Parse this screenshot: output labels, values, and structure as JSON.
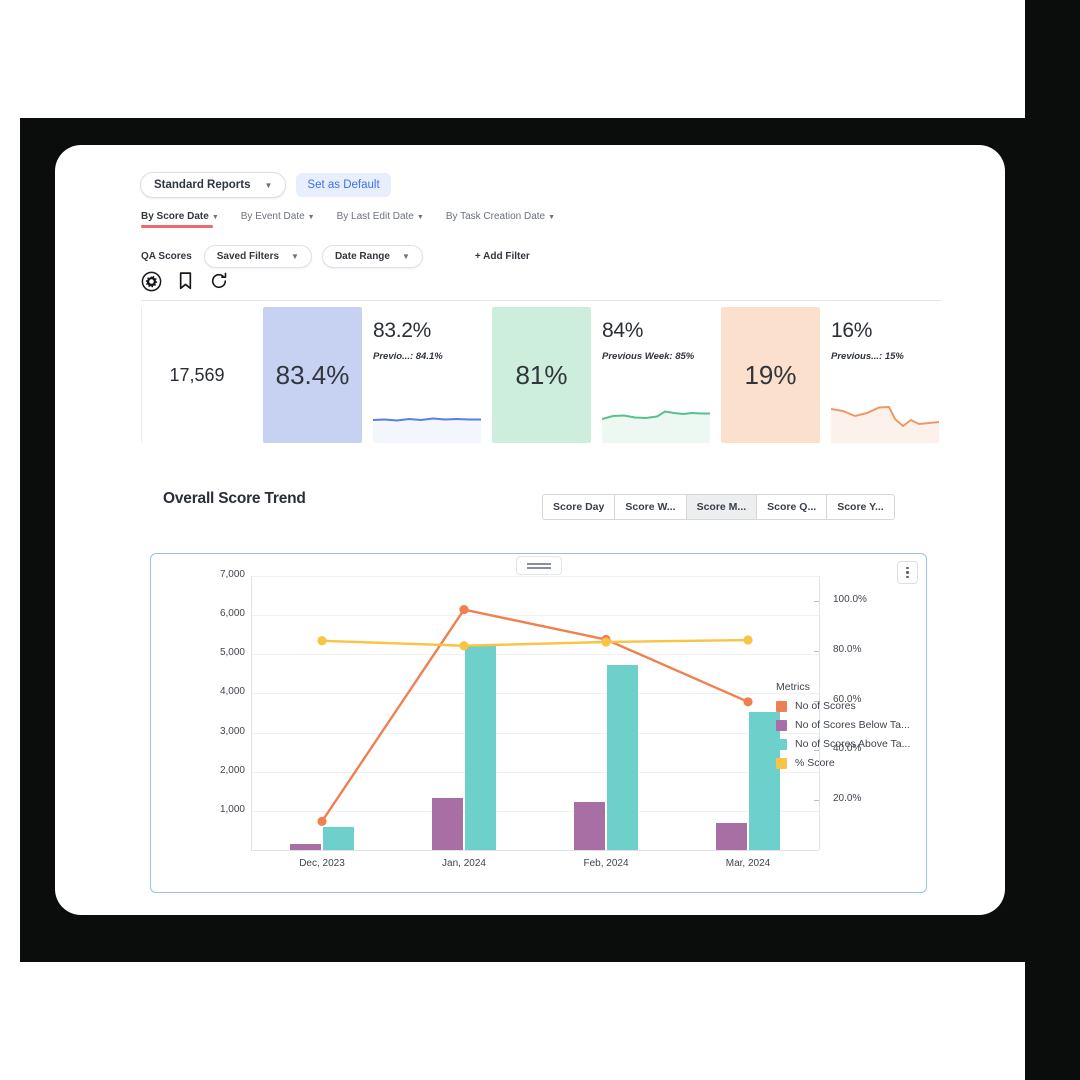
{
  "report": {
    "selector_label": "Standard Reports",
    "set_default_label": "Set as Default"
  },
  "date_tabs": [
    {
      "label": "By Score Date",
      "active": true
    },
    {
      "label": "By Event Date",
      "active": false
    },
    {
      "label": "By Last Edit Date",
      "active": false
    },
    {
      "label": "By Task Creation Date",
      "active": false
    }
  ],
  "filters": {
    "section_label": "QA Scores",
    "saved_filters_label": "Saved Filters",
    "date_range_label": "Date Range",
    "add_filter_label": "+ Add Filter"
  },
  "toolbar_icons": [
    {
      "name": "settings-gear-icon"
    },
    {
      "name": "bookmark-icon"
    },
    {
      "name": "refresh-history-icon"
    }
  ],
  "kpis": [
    {
      "kind": "plain",
      "value": "17,569",
      "bg": "#ffffff"
    },
    {
      "kind": "filled",
      "value": "83.4%",
      "bg": "#c7d2f3"
    },
    {
      "kind": "spark",
      "value": "83.2%",
      "previous": "Previo...: 84.1%",
      "line": "#5b7fe0",
      "fill": "#f4f6fd"
    },
    {
      "kind": "filled",
      "value": "81%",
      "bg": "#cdeedc"
    },
    {
      "kind": "spark",
      "value": "84%",
      "previous": "Previous Week: 85%",
      "line": "#58c08c",
      "fill": "#eef8f2"
    },
    {
      "kind": "filled",
      "value": "19%",
      "bg": "#fbe0cd"
    },
    {
      "kind": "spark",
      "value": "16%",
      "previous": "Previous...: 15%",
      "line": "#ee9866",
      "fill": "#fdf1eb"
    }
  ],
  "chart_section": {
    "title": "Overall Score Trend",
    "segments": [
      {
        "label": "Score Day",
        "active": false
      },
      {
        "label": "Score W...",
        "active": false
      },
      {
        "label": "Score M...",
        "active": true
      },
      {
        "label": "Score Q...",
        "active": false
      },
      {
        "label": "Score Y...",
        "active": false
      }
    ]
  },
  "chart_data": {
    "type": "bar",
    "title": "Overall Score Trend",
    "xlabel": "",
    "ylabel": "",
    "grid": true,
    "legend_position": "right",
    "legend_title": "Metrics",
    "categories": [
      "Dec, 2023",
      "Jan, 2024",
      "Feb, 2024",
      "Mar, 2024"
    ],
    "y_axis": {
      "side": "left",
      "ticks": [
        "1,000",
        "2,000",
        "3,000",
        "4,000",
        "5,000",
        "6,000",
        "7,000"
      ],
      "tickvals": [
        1000,
        2000,
        3000,
        4000,
        5000,
        6000,
        7000
      ],
      "ylim": [
        0,
        7000
      ]
    },
    "y2_axis": {
      "side": "right",
      "ticks": [
        "20.0%",
        "40.0%",
        "60.0%",
        "80.0%",
        "100.0%"
      ],
      "tickvals": [
        20,
        40,
        60,
        80,
        100
      ],
      "ylim": [
        0,
        110
      ]
    },
    "series": [
      {
        "name": "No of Scores",
        "type": "line",
        "color": "#f08050",
        "axis": "y2",
        "values": [
          11.5,
          96.5,
          84.5,
          59.5
        ]
      },
      {
        "name": "No of Scores Below Ta...",
        "type": "bar",
        "color": "#a86fa4",
        "axis": "y",
        "values": [
          160,
          1340,
          1230,
          700
        ]
      },
      {
        "name": "No of Scores Above Ta...",
        "type": "bar",
        "color": "#6ed0cb",
        "axis": "y",
        "values": [
          600,
          5250,
          4730,
          3520
        ]
      },
      {
        "name": "% Score",
        "type": "line",
        "color": "#f9c344",
        "axis": "y2",
        "values": [
          84.0,
          82.0,
          83.5,
          84.3
        ]
      }
    ]
  }
}
